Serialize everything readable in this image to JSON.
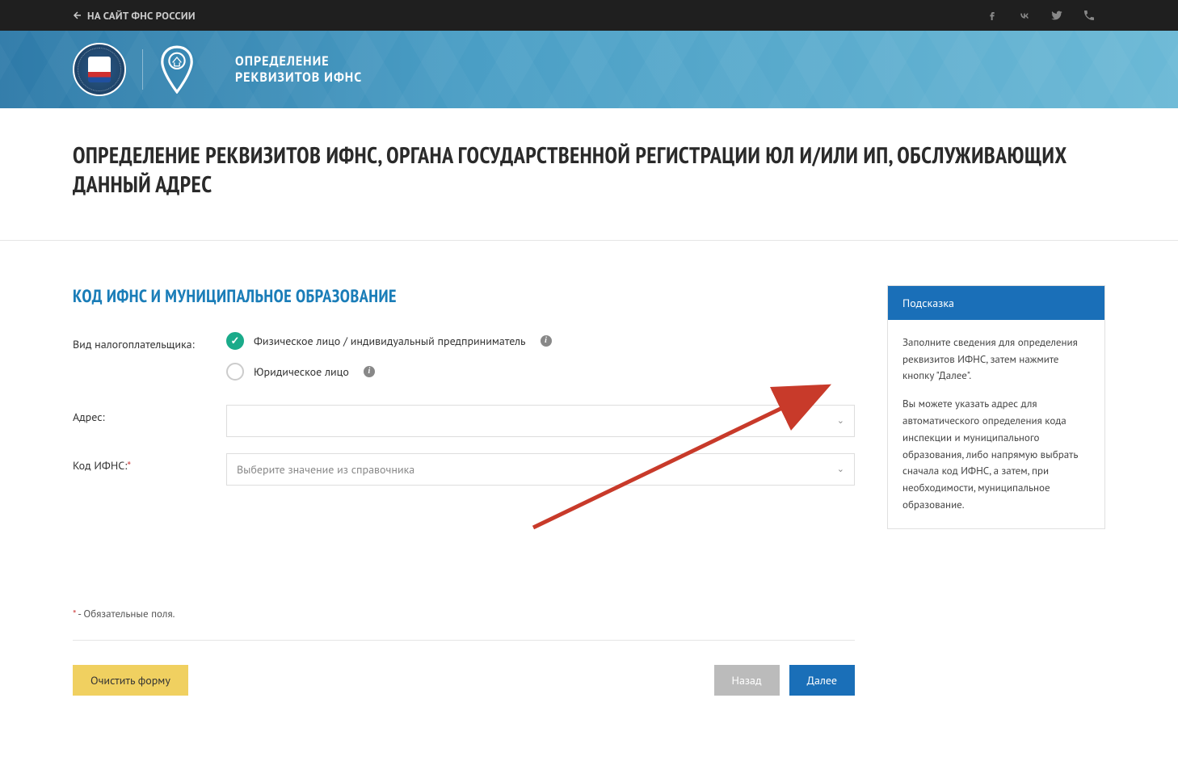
{
  "topbar": {
    "back_label": "НА САЙТ ФНС РОССИИ"
  },
  "header": {
    "title_line1": "ОПРЕДЕЛЕНИЕ",
    "title_line2": "РЕКВИЗИТОВ ИФНС"
  },
  "page": {
    "title": "ОПРЕДЕЛЕНИЕ РЕКВИЗИТОВ ИФНС, ОРГАНА ГОСУДАРСТВЕННОЙ РЕГИСТРАЦИИ ЮЛ И/ИЛИ ИП, ОБСЛУЖИВАЮЩИХ ДАННЫЙ АДРЕС"
  },
  "form": {
    "section_heading": "КОД ИФНС И МУНИЦИПАЛЬНОЕ ОБРАЗОВАНИЕ",
    "taxpayer_label": "Вид налогоплательщика:",
    "taxpayer_options": {
      "individual": "Физическое лицо / индивидуальный предприниматель",
      "legal": "Юридическое лицо"
    },
    "address_label": "Адрес:",
    "address_value": "",
    "code_label": "Код ИФНС:",
    "code_placeholder": "Выберите значение из справочника",
    "required_note": " - Обязательные поля.",
    "required_star": "*"
  },
  "actions": {
    "clear": "Очистить форму",
    "back": "Назад",
    "next": "Далее"
  },
  "hint": {
    "title": "Подсказка",
    "p1": "Заполните сведения для определения реквизитов ИФНС, затем нажмите кнопку \"Далее\".",
    "p2": "Вы можете указать адрес для автоматического определения кода инспекции и муниципального образования, либо напрямую выбрать сначала код ИФНС, а затем, при необходимости, муниципальное образование."
  }
}
